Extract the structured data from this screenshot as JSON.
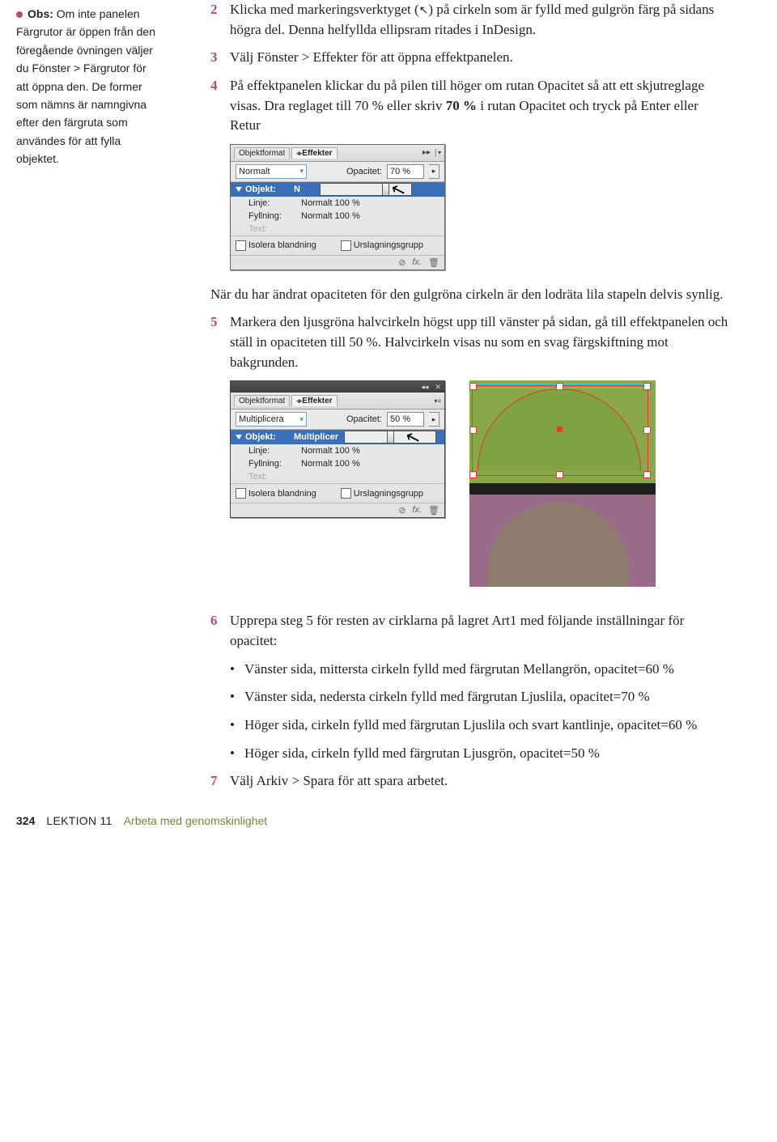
{
  "sidebar": {
    "obs_label": "Obs:",
    "note_text": "Om inte panelen Färgrutor är öppen från den föregående övningen väljer du Fönster > Färgrutor för att öppna den. De former som nämns är namngivna efter den färgruta som användes för att fylla objektet."
  },
  "steps": {
    "s2": "Klicka med markeringsverktyget ( ) på cirkeln som är fylld med gulgrön färg på sidans högra del. Denna helfyllda ellipsram ritades i InDesign.",
    "s2_cursor": "↖",
    "s3": "Välj Fönster > Effekter för att öppna effektpanelen.",
    "s4": "På effektpanelen klickar du på pilen till höger om rutan Opacitet så att ett skjutreglage visas. Dra reglaget till 70 % eller skriv 70 % i rutan Opacitet och tryck på Enter eller Retur",
    "p_mid": "När du har ändrat opaciteten för den gulgröna cirkeln är den lodräta lila stapeln delvis synlig.",
    "s5": "Markera den ljusgröna halvcirkeln högst upp till vänster på sidan, gå till effektpanelen och ställ in opaciteten till 50 %. Halvcirkeln visas nu som en svag färgskiftning mot bakgrunden.",
    "s6": "Upprepa steg 5 för resten av cirklarna på lagret Art1 med följande inställningar för opacitet:",
    "b1": "Vänster sida, mittersta cirkeln fylld med färgrutan Mellangrön, opacitet=60 %",
    "b2": "Vänster sida, nedersta cirkeln fylld med färgrutan Ljuslila, opacitet=70 %",
    "b3": "Höger sida, cirkeln fylld med färgrutan Ljuslila och svart kantlinje, opacitet=60 %",
    "b4": "Höger sida, cirkeln fylld med färgrutan Ljusgrön, opacitet=50 %",
    "s7": "Välj Arkiv > Spara för att spara arbetet."
  },
  "panel1": {
    "tab_objektformat": "Objektformat",
    "tab_effekter": "Effekter",
    "mode": "Normalt",
    "opac_label": "Opacitet:",
    "opac_value": "70 %",
    "objekt": "Objekt:",
    "objekt_val": "N",
    "linje_k": "Linje:",
    "linje_v": "Normalt 100 %",
    "fyll_k": "Fyllning:",
    "fyll_v": "Normalt 100 %",
    "text_k": "Text:",
    "chk_isolera": "Isolera blandning",
    "chk_urslag": "Urslagningsgrupp",
    "foot_fx": "fx.",
    "foot_trash": "🗑"
  },
  "panel2": {
    "tab_objektformat": "Objektformat",
    "tab_effekter": "Effekter",
    "mode": "Multiplicera",
    "opac_label": "Opacitet:",
    "opac_value": "50 %",
    "objekt": "Objekt:",
    "objekt_val": "Multiplicer",
    "linje_k": "Linje:",
    "linje_v": "Normalt 100 %",
    "fyll_k": "Fyllning:",
    "fyll_v": "Normalt 100 %",
    "text_k": "Text:",
    "chk_isolera": "Isolera blandning",
    "chk_urslag": "Urslagningsgrupp",
    "foot_fx": "fx.",
    "foot_trash": "🗑"
  },
  "footer": {
    "pagenum": "324",
    "lesson": "LEKTION 11",
    "title": "Arbeta med genomskinlighet"
  }
}
